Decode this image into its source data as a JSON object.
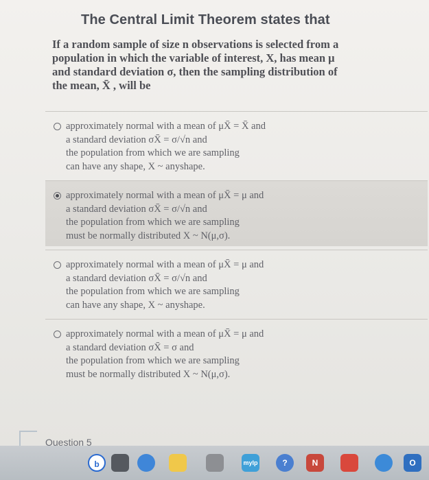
{
  "question": {
    "title": "The Central Limit Theorem states that",
    "stem_lines": [
      "If a random sample of size n observations is selected from a",
      "population in which the variable of interest, X, has mean μ",
      "and standard deviation σ, then the sampling distribution of",
      "the mean, X̄ , will be"
    ]
  },
  "options": [
    {
      "selected": false,
      "lines": [
        "approximately normal with a mean of μX̄ = X̄ and",
        "a standard deviation σX̄ = σ/√n and",
        "the population from which we are sampling",
        "can have any shape, X ~ anyshape."
      ]
    },
    {
      "selected": true,
      "lines": [
        "approximately normal with a mean of μX̄ = μ and",
        "a standard deviation σX̄ = σ/√n and",
        "the population from which we are sampling",
        "must be normally distributed X ~ N(μ,σ)."
      ]
    },
    {
      "selected": false,
      "lines": [
        "approximately normal with a mean of μX̄ = μ and",
        "a standard deviation σX̄ = σ/√n and",
        "the population from which we are sampling",
        "can have any shape, X ~ anyshape."
      ]
    },
    {
      "selected": false,
      "lines": [
        "approximately normal with a mean of μX̄ = μ and",
        "a standard deviation σX̄ = σ and",
        "the population from which we are sampling",
        "must be normally distributed X ~ N(μ,σ)."
      ]
    }
  ],
  "next_question_label": "Question 5",
  "dock": {
    "icons": [
      {
        "name": "browser-b-icon",
        "label": "b",
        "color": "#ffffff"
      },
      {
        "name": "finder-icon",
        "label": "",
        "color": "#555a60"
      },
      {
        "name": "messages-icon",
        "label": "",
        "color": "#3f86d8"
      },
      {
        "name": "notes-icon",
        "label": "",
        "color": "#f0c84a"
      },
      {
        "name": "calculator-icon",
        "label": "",
        "color": "#8d8f93"
      },
      {
        "name": "app-myelp-icon",
        "label": "mylp",
        "color": "#3fa0d8"
      },
      {
        "name": "help-icon",
        "label": "?",
        "color": "#4a7fd0"
      },
      {
        "name": "app-n-icon",
        "label": "N",
        "color": "#c8483c"
      },
      {
        "name": "app-red-icon",
        "label": "",
        "color": "#d9483c"
      },
      {
        "name": "chrome-icon",
        "label": "",
        "color": "#3c8ad8"
      },
      {
        "name": "outlook-icon",
        "label": "O",
        "color": "#2f6fc0"
      }
    ]
  }
}
